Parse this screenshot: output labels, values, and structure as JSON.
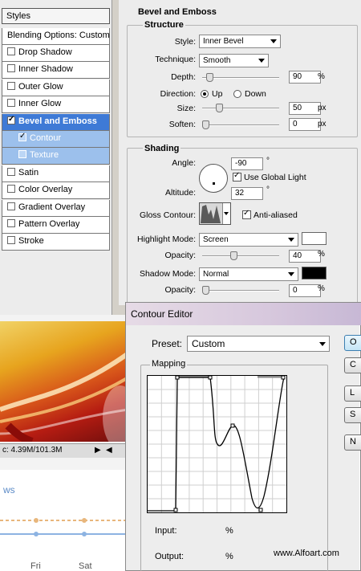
{
  "styles_panel": {
    "title": "Styles",
    "blending_options": "Blending Options: Custom",
    "items": [
      {
        "label": "Drop Shadow",
        "checked": false,
        "state": "normal"
      },
      {
        "label": "Inner Shadow",
        "checked": false,
        "state": "normal"
      },
      {
        "label": "Outer Glow",
        "checked": false,
        "state": "normal"
      },
      {
        "label": "Inner Glow",
        "checked": false,
        "state": "normal"
      },
      {
        "label": "Bevel and Emboss",
        "checked": true,
        "state": "active"
      },
      {
        "label": "Contour",
        "checked": true,
        "state": "sub"
      },
      {
        "label": "Texture",
        "checked": false,
        "state": "sub"
      },
      {
        "label": "Satin",
        "checked": false,
        "state": "normal"
      },
      {
        "label": "Color Overlay",
        "checked": false,
        "state": "normal"
      },
      {
        "label": "Gradient Overlay",
        "checked": false,
        "state": "normal"
      },
      {
        "label": "Pattern Overlay",
        "checked": false,
        "state": "normal"
      },
      {
        "label": "Stroke",
        "checked": false,
        "state": "normal"
      }
    ]
  },
  "bevel": {
    "section_title": "Bevel and Emboss",
    "structure_title": "Structure",
    "style_label": "Style:",
    "style_value": "Inner Bevel",
    "technique_label": "Technique:",
    "technique_value": "Smooth",
    "depth_label": "Depth:",
    "depth_value": "90",
    "depth_unit": "%",
    "depth_slider_fraction": 0.06,
    "direction_label": "Direction:",
    "direction_up": "Up",
    "direction_down": "Down",
    "direction_selected": "Up",
    "size_label": "Size:",
    "size_value": "50",
    "size_unit": "px",
    "size_slider_fraction": 0.2,
    "soften_label": "Soften:",
    "soften_value": "0",
    "soften_unit": "px",
    "soften_slider_fraction": 0.0
  },
  "shading": {
    "title": "Shading",
    "angle_label": "Angle:",
    "angle_value": "-90",
    "angle_unit": "°",
    "use_global_light": "Use Global Light",
    "use_global_light_checked": true,
    "altitude_label": "Altitude:",
    "altitude_value": "32",
    "altitude_unit": "°",
    "gloss_contour_label": "Gloss Contour:",
    "anti_aliased": "Anti-aliased",
    "anti_aliased_checked": true,
    "highlight_mode_label": "Highlight Mode:",
    "highlight_mode_value": "Screen",
    "highlight_color": "#ffffff",
    "highlight_opacity_label": "Opacity:",
    "highlight_opacity_value": "40",
    "highlight_opacity_unit": "%",
    "highlight_opacity_fraction": 0.4,
    "shadow_mode_label": "Shadow Mode:",
    "shadow_mode_value": "Normal",
    "shadow_color": "#000000",
    "shadow_opacity_label": "Opacity:",
    "shadow_opacity_value": "0",
    "shadow_opacity_unit": "%",
    "shadow_opacity_fraction": 0.0
  },
  "background": {
    "status_text": "c: 4.39M/101.3M",
    "chart_title_fragment": "ws",
    "day_labels": [
      "Fri",
      "Sat"
    ]
  },
  "contour_editor": {
    "title": "Contour Editor",
    "preset_label": "Preset:",
    "preset_value": "Custom",
    "mapping_label": "Mapping",
    "input_label": "Input:",
    "input_unit": "%",
    "output_label": "Output:",
    "output_unit": "%",
    "buttons": [
      "O",
      "C",
      "L",
      "S",
      "N"
    ],
    "watermark": "www.Alfoart.com"
  }
}
